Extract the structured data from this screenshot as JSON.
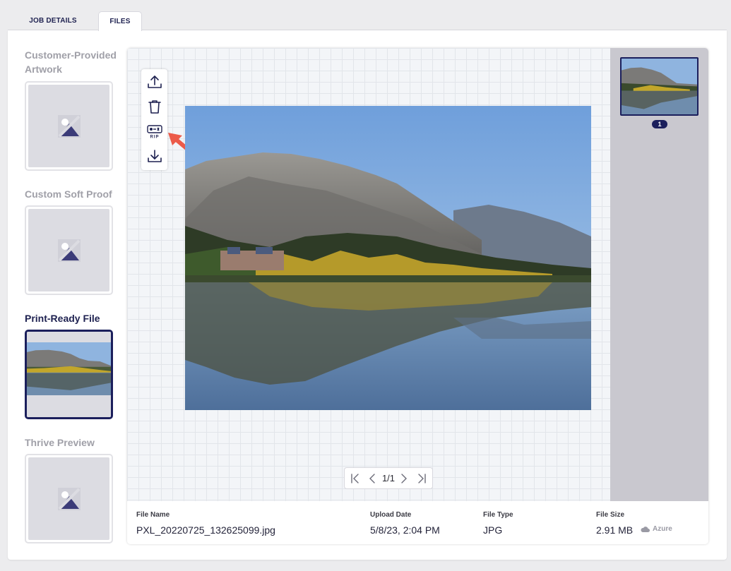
{
  "tabs": [
    {
      "label": "JOB DETAILS",
      "active": false
    },
    {
      "label": "FILES",
      "active": true
    }
  ],
  "sidebar": {
    "items": [
      {
        "label": "Customer-Provided Artwork",
        "has_image": false
      },
      {
        "label": "Custom Soft Proof",
        "has_image": false
      },
      {
        "label": "Print-Ready File",
        "has_image": true,
        "active": true
      },
      {
        "label": "Thrive Preview",
        "has_image": false
      }
    ]
  },
  "toolbar": {
    "tools": [
      {
        "name": "upload-icon"
      },
      {
        "name": "trash-icon"
      },
      {
        "name": "rip-icon",
        "text": "RIP"
      },
      {
        "name": "download-icon"
      }
    ]
  },
  "pager": {
    "text": "1/1"
  },
  "thumbnails": [
    {
      "badge": "1",
      "selected": true
    }
  ],
  "file_info": {
    "file_name_label": "File Name",
    "file_name": "PXL_20220725_132625099.jpg",
    "upload_date_label": "Upload Date",
    "upload_date": "5/8/23, 2:04 PM",
    "file_type_label": "File Type",
    "file_type": "JPG",
    "file_size_label": "File Size",
    "file_size": "2.91 MB",
    "storage": "Azure"
  },
  "colors": {
    "accent": "#1b1f5c",
    "annotation_arrow": "#ec5b4a"
  }
}
